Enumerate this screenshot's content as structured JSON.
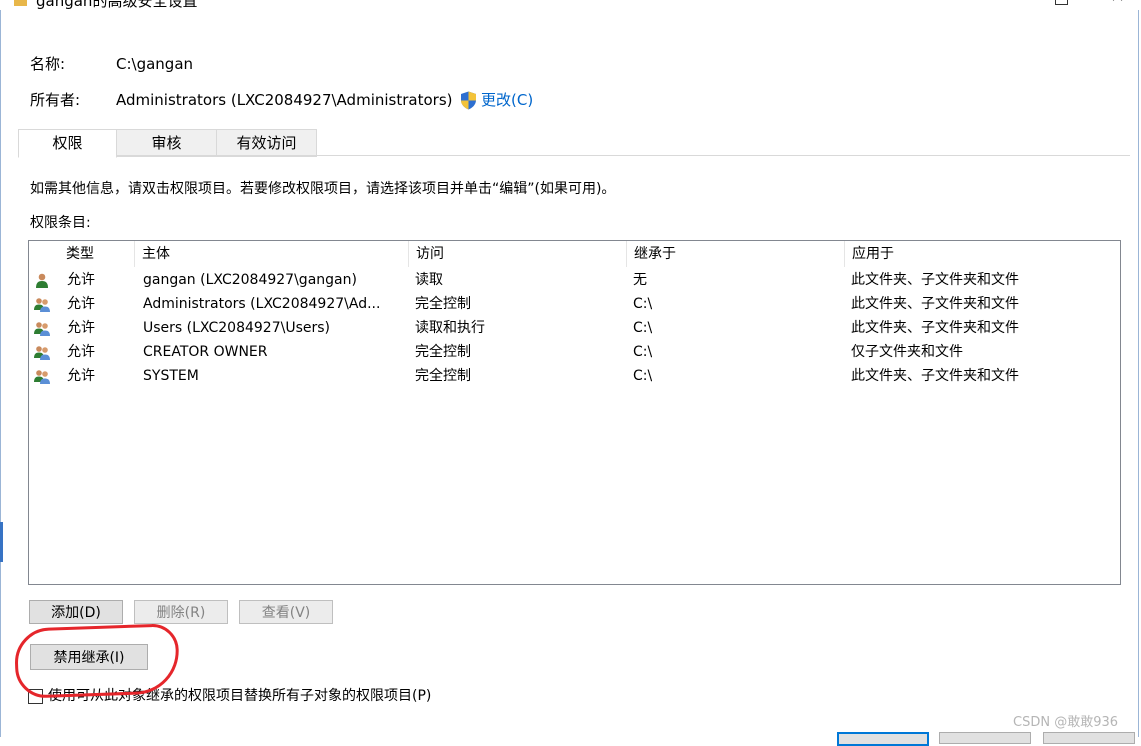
{
  "window": {
    "title": "gangan的高级安全设置"
  },
  "name_row": {
    "label": "名称:",
    "value": "C:\\gangan"
  },
  "owner_row": {
    "label": "所有者:",
    "value": "Administrators (LXC2084927\\Administrators)",
    "change_link": "更改(C)"
  },
  "tabs": [
    {
      "label": "权限",
      "active": true
    },
    {
      "label": "审核",
      "active": false
    },
    {
      "label": "有效访问",
      "active": false
    }
  ],
  "info_text": "如需其他信息，请双击权限项目。若要修改权限项目，请选择该项目并单击“编辑”(如果可用)。",
  "entries_label": "权限条目:",
  "columns": [
    "类型",
    "主体",
    "访问",
    "继承于",
    "应用于"
  ],
  "entries": [
    {
      "icon": "user-icon",
      "type": "允许",
      "principal": "gangan (LXC2084927\\gangan)",
      "access": "读取",
      "inherited_from": "无",
      "applies_to": "此文件夹、子文件夹和文件"
    },
    {
      "icon": "group-icon",
      "type": "允许",
      "principal": "Administrators (LXC2084927\\Ad...",
      "access": "完全控制",
      "inherited_from": "C:\\",
      "applies_to": "此文件夹、子文件夹和文件"
    },
    {
      "icon": "group-icon",
      "type": "允许",
      "principal": "Users (LXC2084927\\Users)",
      "access": "读取和执行",
      "inherited_from": "C:\\",
      "applies_to": "此文件夹、子文件夹和文件"
    },
    {
      "icon": "group-icon",
      "type": "允许",
      "principal": "CREATOR OWNER",
      "access": "完全控制",
      "inherited_from": "C:\\",
      "applies_to": "仅子文件夹和文件"
    },
    {
      "icon": "group-icon",
      "type": "允许",
      "principal": "SYSTEM",
      "access": "完全控制",
      "inherited_from": "C:\\",
      "applies_to": "此文件夹、子文件夹和文件"
    }
  ],
  "buttons": {
    "add": "添加(D)",
    "remove": "删除(R)",
    "view": "查看(V)",
    "disable_inheritance": "禁用继承(I)"
  },
  "replace_checkbox": {
    "label": "使用可从此对象继承的权限项目替换所有子对象的权限项目(P)",
    "checked": false
  },
  "watermark": "CSDN @敢敢936",
  "colors": {
    "link": "#0066cc",
    "annotation_circle": "#e5262b",
    "default_button_border": "#0078d7"
  }
}
